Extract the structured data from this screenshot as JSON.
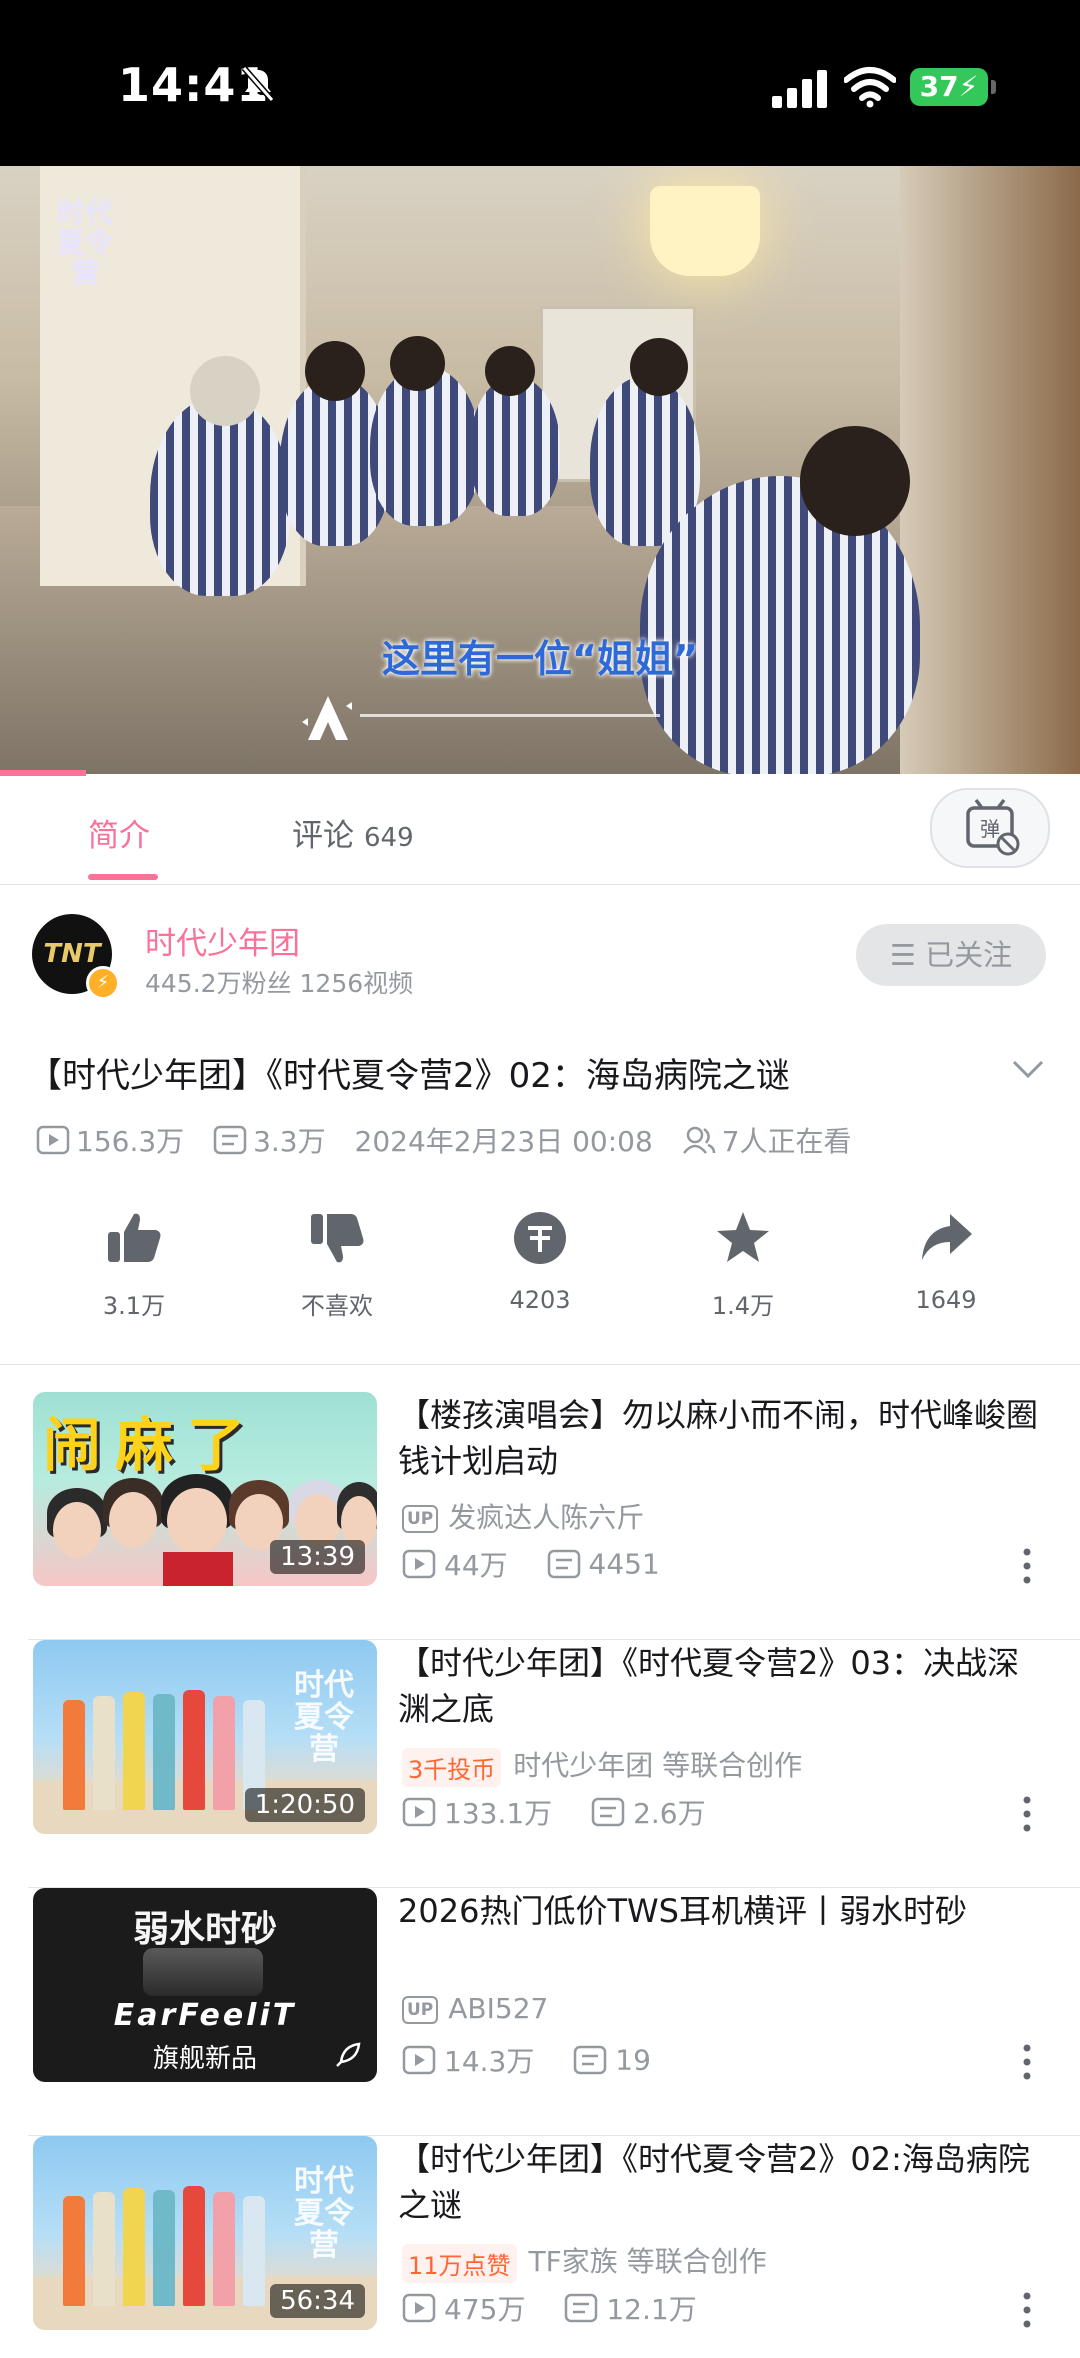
{
  "status_bar": {
    "time": "14:41",
    "battery": "37"
  },
  "player": {
    "subtitle": "这里有一位“姐姐”",
    "logo_text": "时代夏令营",
    "progress_fraction": 0.08
  },
  "tabs": {
    "intro": "简介",
    "comments": "评论",
    "comments_count": "649"
  },
  "uploader": {
    "avatar_text": "TNT",
    "name": "时代少年团",
    "stats": "445.2万粉丝  1256视频",
    "follow_label": "☰ 已关注"
  },
  "video": {
    "title": "【时代少年团】《时代夏令营2》02：海岛病院之谜",
    "views": "156.3万",
    "danmaku": "3.3万",
    "date": "2024年2月23日 00:08",
    "watching": "7人正在看"
  },
  "actions": {
    "like": "3.1万",
    "dislike": "不喜欢",
    "coin": "4203",
    "favorite": "1.4万",
    "share": "1649"
  },
  "recommendations": [
    {
      "title": "【楼孩演唱会】勿以麻小而不闹，时代峰峻圈钱计划启动",
      "thumb_text": "闹麻了",
      "duration": "13:39",
      "tag": "",
      "author": "发疯达人陈六斤",
      "views": "44万",
      "danmaku": "4451"
    },
    {
      "title": "【时代少年团】《时代夏令营2》03：决战深渊之底",
      "thumb_text": "时代夏令营",
      "duration": "1:20:50",
      "tag": "3千投币",
      "author": "时代少年团 等联合创作",
      "views": "133.1万",
      "danmaku": "2.6万"
    },
    {
      "title": "2026热门低价TWS耳机横评丨弱水时砂",
      "thumb_text": "弱水时砂",
      "thumb_text2": "EarFeeliT",
      "thumb_text3": "旗舰新品",
      "duration": "",
      "tag": "",
      "author": "ABI527",
      "views": "14.3万",
      "danmaku": "19"
    },
    {
      "title": "【时代少年团】《时代夏令营2》02:海岛病院之谜",
      "thumb_text": "时代夏令营",
      "duration": "56:34",
      "tag": "11万点赞",
      "author": "TF家族 等联合创作",
      "views": "475万",
      "danmaku": "12.1万"
    }
  ],
  "colors": {
    "accent": "#fb7299",
    "text_primary": "#18191c",
    "text_secondary": "#9499a0",
    "coin_tag": "#ff6633"
  }
}
